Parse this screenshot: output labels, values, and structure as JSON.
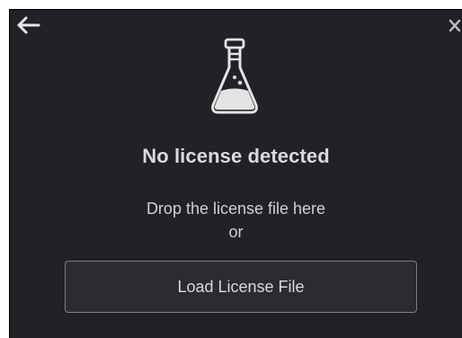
{
  "dialog": {
    "back_icon": "arrow-left-icon",
    "close_icon": "close-icon",
    "illustration_icon": "flask-icon",
    "title": "No license detected",
    "hint_line1": "Drop the license file here",
    "hint_line2": "or",
    "load_button_label": "Load License File"
  }
}
